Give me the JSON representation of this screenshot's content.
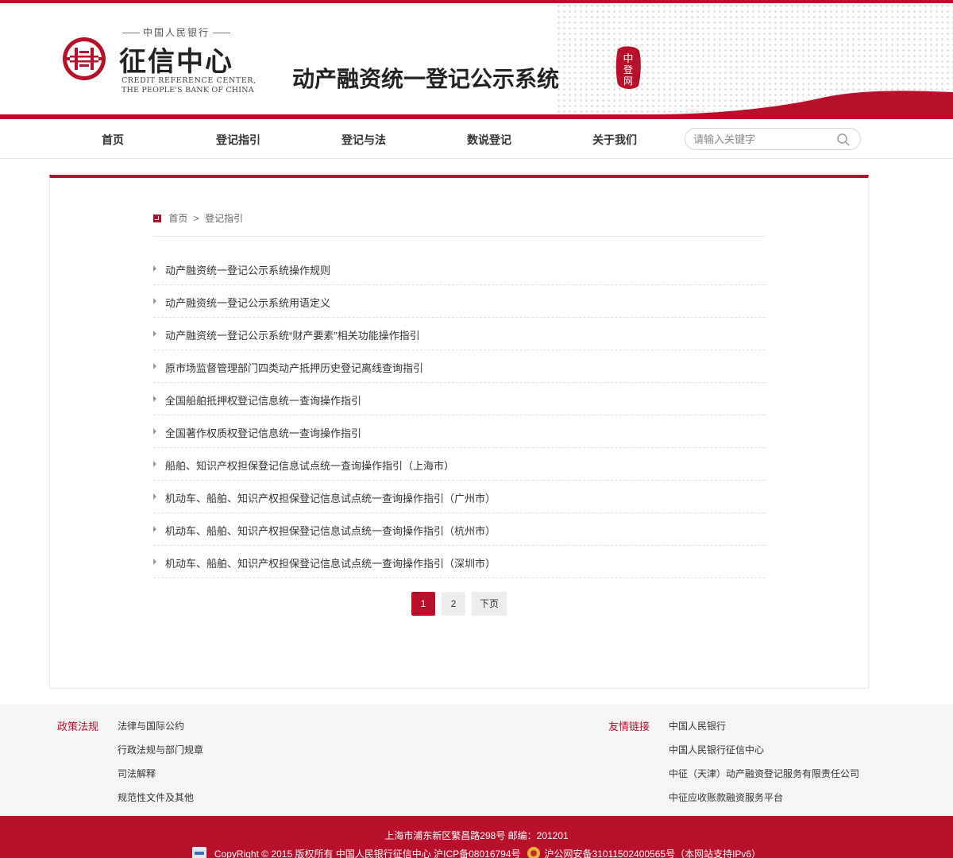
{
  "header": {
    "logo_top_text": "中国人民银行",
    "logo_name": "征信中心",
    "logo_en_line1": "CREDIT REFERENCE CENTER,",
    "logo_en_line2": "THE PEOPLE'S BANK OF CHINA",
    "system_title": "动产融资统一登记公示系统",
    "seal_text": "中登网"
  },
  "nav": {
    "items": [
      {
        "label": "首页"
      },
      {
        "label": "登记指引"
      },
      {
        "label": "登记与法"
      },
      {
        "label": "数说登记"
      },
      {
        "label": "关于我们"
      }
    ],
    "search_placeholder": "请输入关键字"
  },
  "breadcrumb": {
    "home": "首页",
    "separator": ">",
    "current": "登记指引"
  },
  "articles": [
    "动产融资统一登记公示系统操作规则",
    "动产融资统一登记公示系统用语定义",
    "动产融资统一登记公示系统“财产要素”相关功能操作指引",
    "原市场监督管理部门四类动产抵押历史登记离线查询指引",
    "全国船舶抵押权登记信息统一查询操作指引",
    "全国著作权质权登记信息统一查询操作指引",
    "船舶、知识产权担保登记信息试点统一查询操作指引（上海市）",
    "机动车、船舶、知识产权担保登记信息试点统一查询操作指引（广州市）",
    "机动车、船舶、知识产权担保登记信息试点统一查询操作指引（杭州市）",
    "机动车、船舶、知识产权担保登记信息试点统一查询操作指引（深圳市）"
  ],
  "pagination": {
    "current": "1",
    "page2": "2",
    "next": "下页"
  },
  "footer": {
    "policy_title": "政策法规",
    "policy_links": [
      "法律与国际公约",
      "行政法规与部门规章",
      "司法解释",
      "规范性文件及其他"
    ],
    "friend_title": "友情链接",
    "friend_links": [
      "中国人民银行",
      "中国人民银行征信中心",
      "中征（天津）动产融资登记服务有限责任公司",
      "中征应收账款融资服务平台"
    ],
    "address": "上海市浦东新区繁昌路298号 邮编：201201",
    "copyright": "CopyRight © 2015 版权所有 中国人民银行征信中心 沪ICP备08016794号",
    "police_record": "沪公网安备31011502400565号（本网站支持IPv6）"
  },
  "colors": {
    "brand_red": "#b8102a"
  }
}
